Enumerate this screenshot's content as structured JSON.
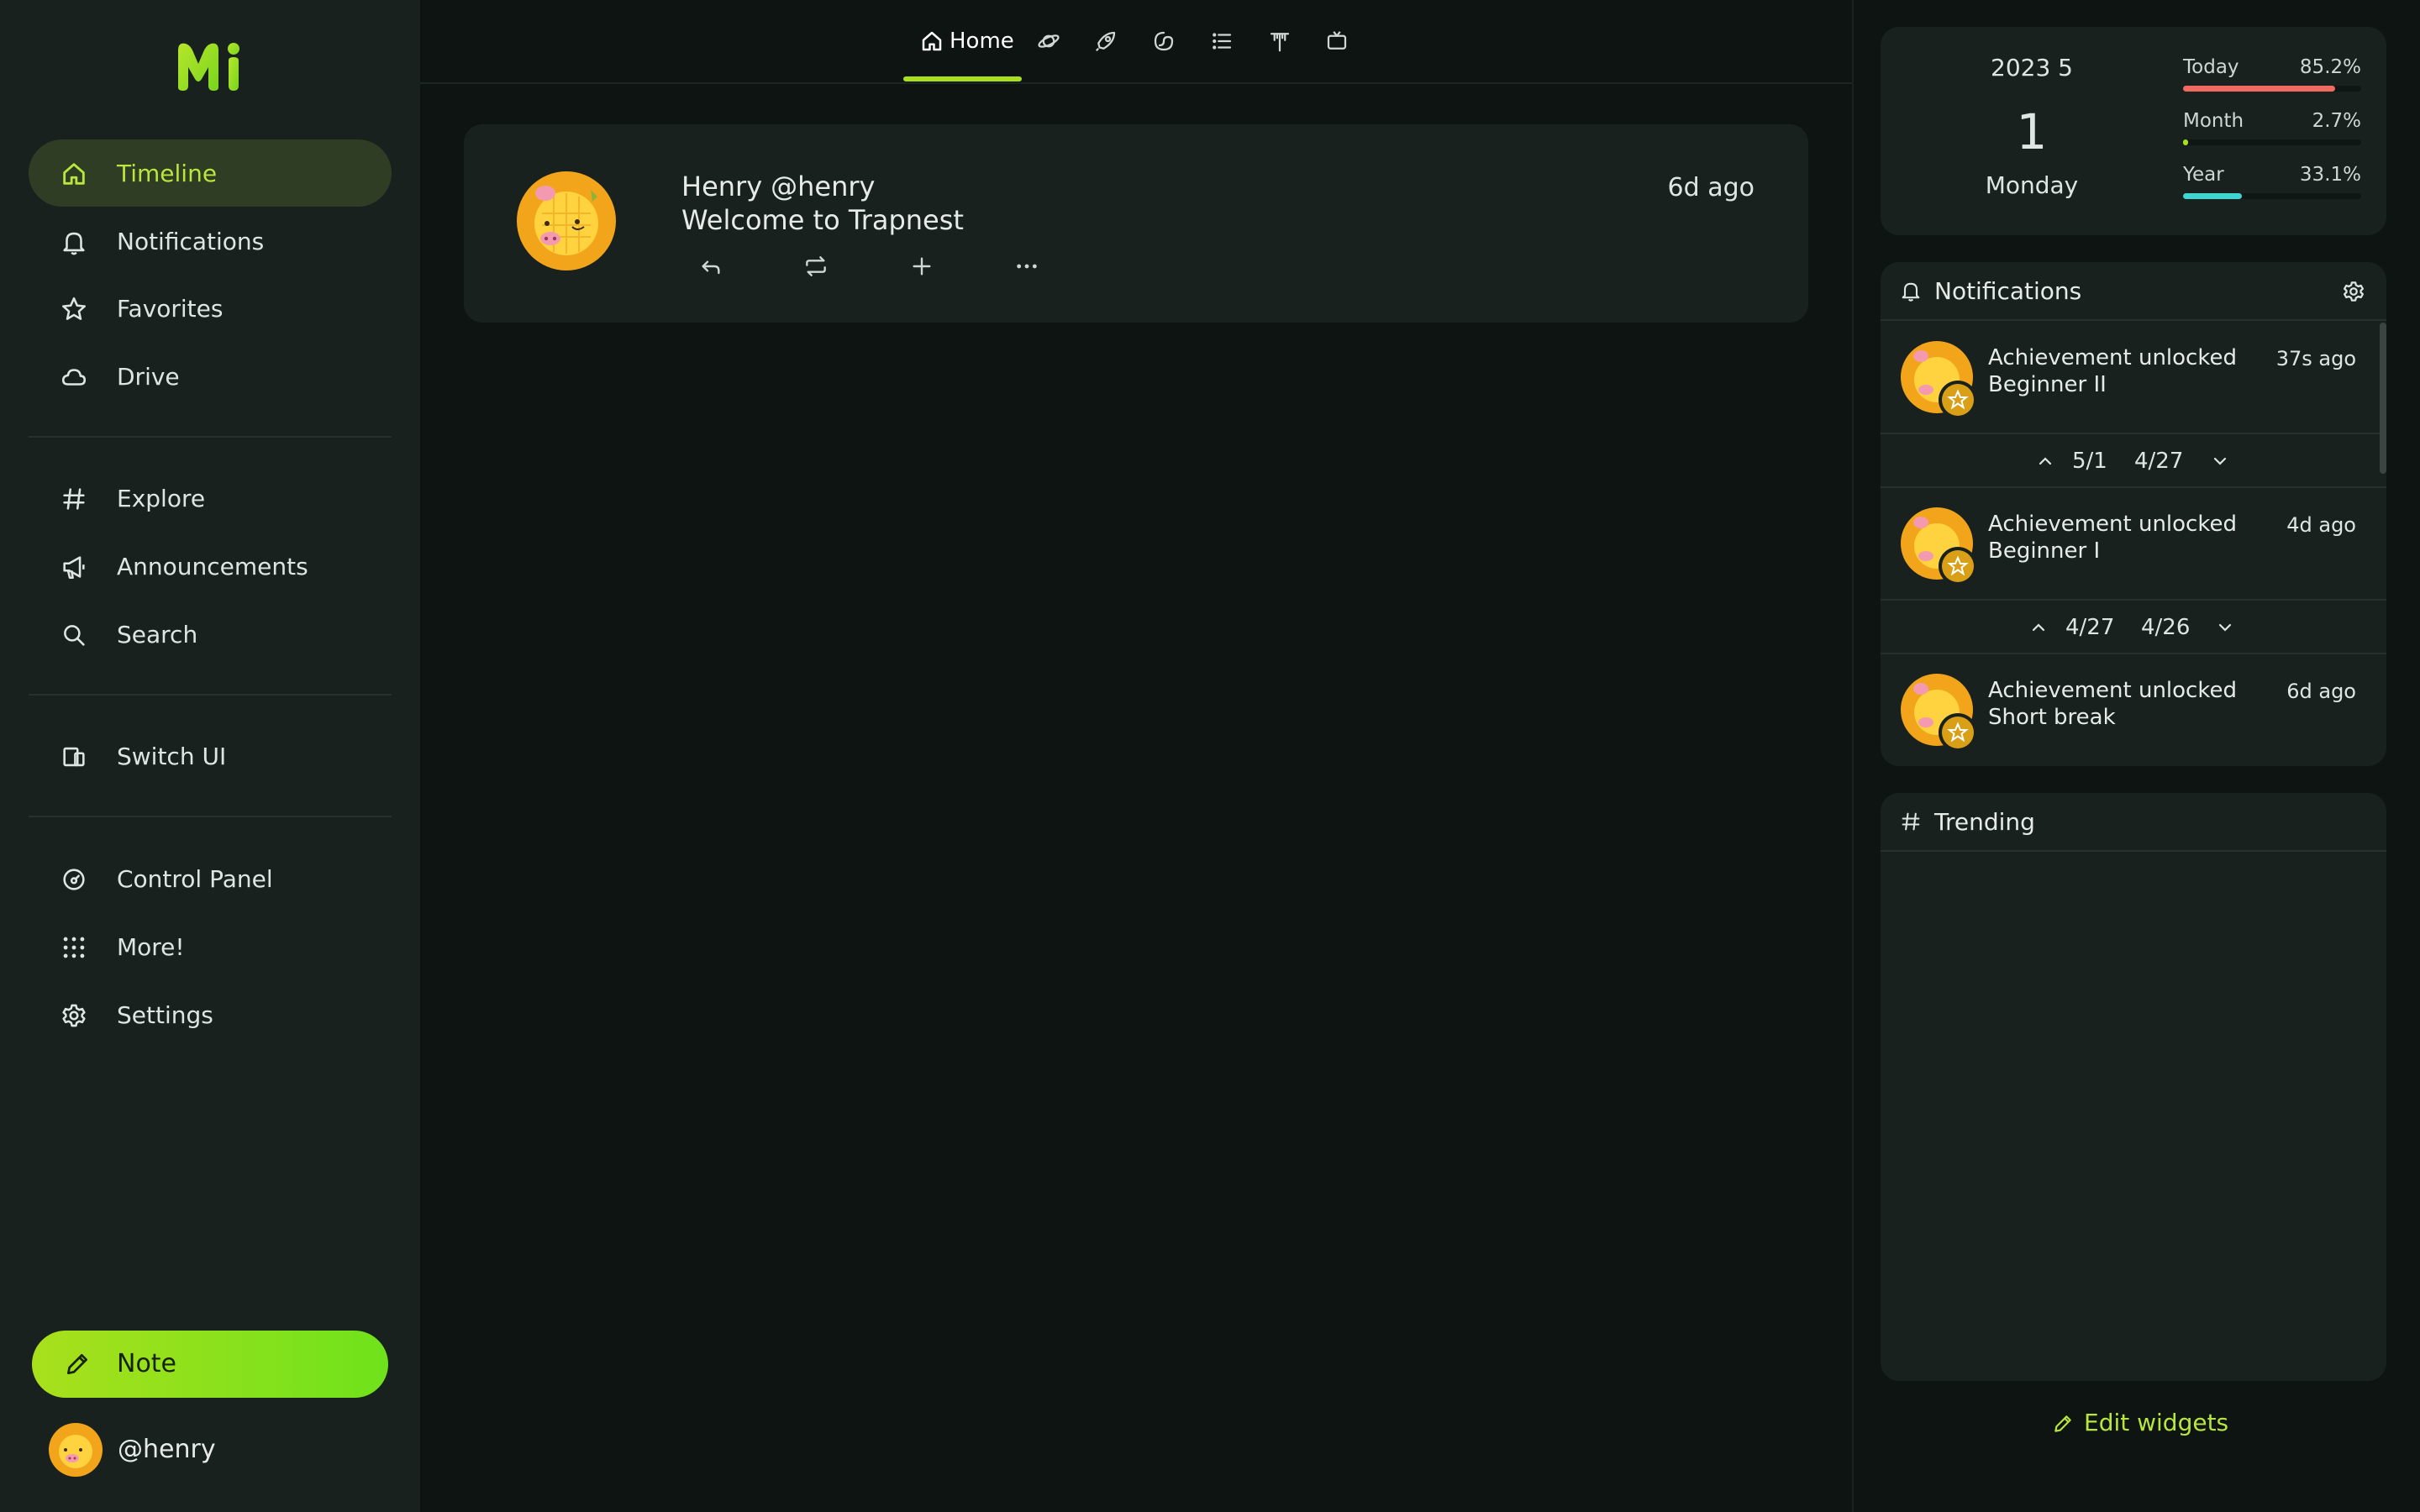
{
  "colors": {
    "accent": "#a9e01c",
    "active_text": "#b9e63d",
    "active_bg": "#2f3d24",
    "sidebar_bg": "#19211f",
    "main_bg": "#0e1412",
    "progress_today": "#f06a62",
    "progress_month": "#a9e01c",
    "progress_year": "#3fd6d1"
  },
  "sidebar": {
    "logo": "Mi",
    "nav_primary": [
      {
        "label": "Timeline",
        "icon": "home-icon",
        "active": true
      },
      {
        "label": "Notifications",
        "icon": "bell-icon"
      },
      {
        "label": "Favorites",
        "icon": "star-icon"
      },
      {
        "label": "Drive",
        "icon": "cloud-icon"
      }
    ],
    "nav_secondary": [
      {
        "label": "Explore",
        "icon": "hash-icon"
      },
      {
        "label": "Announcements",
        "icon": "megaphone-icon"
      },
      {
        "label": "Search",
        "icon": "search-icon"
      }
    ],
    "nav_tertiary": [
      {
        "label": "Switch UI",
        "icon": "devices-icon"
      }
    ],
    "nav_bottom": [
      {
        "label": "Control Panel",
        "icon": "gauge-icon"
      },
      {
        "label": "More!",
        "icon": "grid-dots-icon"
      },
      {
        "label": "Settings",
        "icon": "gear-icon"
      }
    ],
    "note_button": "Note",
    "account": "@henry"
  },
  "tabs": {
    "home_label": "Home",
    "icons": [
      "planet-icon",
      "rocket-icon",
      "whirl-icon",
      "list-icon",
      "antenna-icon",
      "tv-icon"
    ]
  },
  "note": {
    "name": "Henry",
    "username": "@henry",
    "text": "Welcome to Trapnest",
    "time": "6d ago",
    "actions": [
      "reply-icon",
      "renote-icon",
      "plus-icon",
      "more-icon"
    ]
  },
  "calendar": {
    "year_month": "2023  5",
    "day": "1",
    "weekday": "Monday",
    "progress": [
      {
        "label": "Today",
        "value": "85.2%",
        "fraction": 0.852
      },
      {
        "label": "Month",
        "value": "2.7%",
        "fraction": 0.027
      },
      {
        "label": "Year",
        "value": "33.1%",
        "fraction": 0.331
      }
    ]
  },
  "notifications_widget": {
    "title": "Notifications",
    "items": [
      {
        "line1": "Achievement unlocked",
        "line2": "Beginner II",
        "time": "37s ago"
      },
      {
        "line1": "Achievement unlocked",
        "line2": "Beginner I",
        "time": "4d ago"
      },
      {
        "line1": "Achievement unlocked",
        "line2": "Short break",
        "time": "6d ago"
      }
    ],
    "separators": [
      {
        "newer": "5/1",
        "older": "4/27"
      },
      {
        "newer": "4/27",
        "older": "4/26"
      }
    ]
  },
  "trending_widget": {
    "title": "Trending"
  },
  "edit_widgets": "Edit widgets"
}
